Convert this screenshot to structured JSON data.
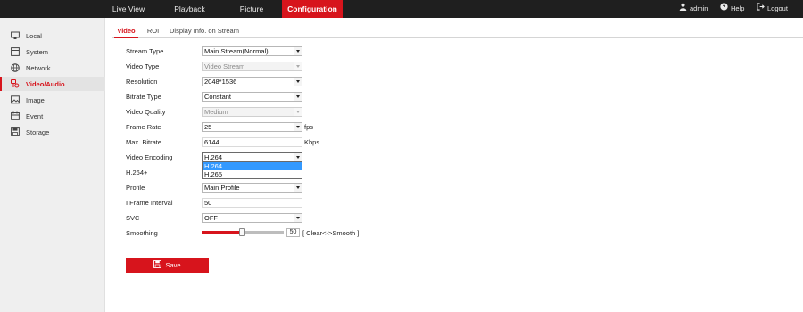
{
  "topnav": {
    "items": [
      {
        "label": "Live View"
      },
      {
        "label": "Playback"
      },
      {
        "label": "Picture"
      },
      {
        "label": "Configuration"
      }
    ],
    "user": "admin",
    "help": "Help",
    "logout": "Logout"
  },
  "sidebar": {
    "items": [
      {
        "label": "Local",
        "icon": "monitor-icon"
      },
      {
        "label": "System",
        "icon": "system-icon"
      },
      {
        "label": "Network",
        "icon": "globe-icon"
      },
      {
        "label": "Video/Audio",
        "icon": "video-audio-icon"
      },
      {
        "label": "Image",
        "icon": "image-icon"
      },
      {
        "label": "Event",
        "icon": "calendar-icon"
      },
      {
        "label": "Storage",
        "icon": "storage-icon"
      }
    ]
  },
  "tabs": [
    {
      "label": "Video"
    },
    {
      "label": "ROI"
    },
    {
      "label": "Display Info. on Stream"
    }
  ],
  "form": {
    "stream_type": {
      "label": "Stream Type",
      "value": "Main Stream(Normal)"
    },
    "video_type": {
      "label": "Video Type",
      "value": "Video Stream"
    },
    "resolution": {
      "label": "Resolution",
      "value": "2048*1536"
    },
    "bitrate_type": {
      "label": "Bitrate Type",
      "value": "Constant"
    },
    "video_quality": {
      "label": "Video Quality",
      "value": "Medium"
    },
    "frame_rate": {
      "label": "Frame Rate",
      "value": "25",
      "unit": "fps"
    },
    "max_bitrate": {
      "label": "Max. Bitrate",
      "value": "6144",
      "unit": "Kbps"
    },
    "video_encoding": {
      "label": "Video Encoding",
      "value": "H.264",
      "options": [
        "H.264",
        "H.265"
      ]
    },
    "h264plus": {
      "label": "H.264+"
    },
    "profile": {
      "label": "Profile",
      "value": "Main Profile"
    },
    "i_frame_interval": {
      "label": "I Frame Interval",
      "value": "50"
    },
    "svc": {
      "label": "SVC",
      "value": "OFF"
    },
    "smoothing": {
      "label": "Smoothing",
      "value": "50",
      "hint": "[ Clear<->Smooth ]"
    }
  },
  "save_label": "Save",
  "colors": {
    "accent": "#d7141c",
    "topbar": "#1f1f1f",
    "selection": "#3399ff"
  }
}
